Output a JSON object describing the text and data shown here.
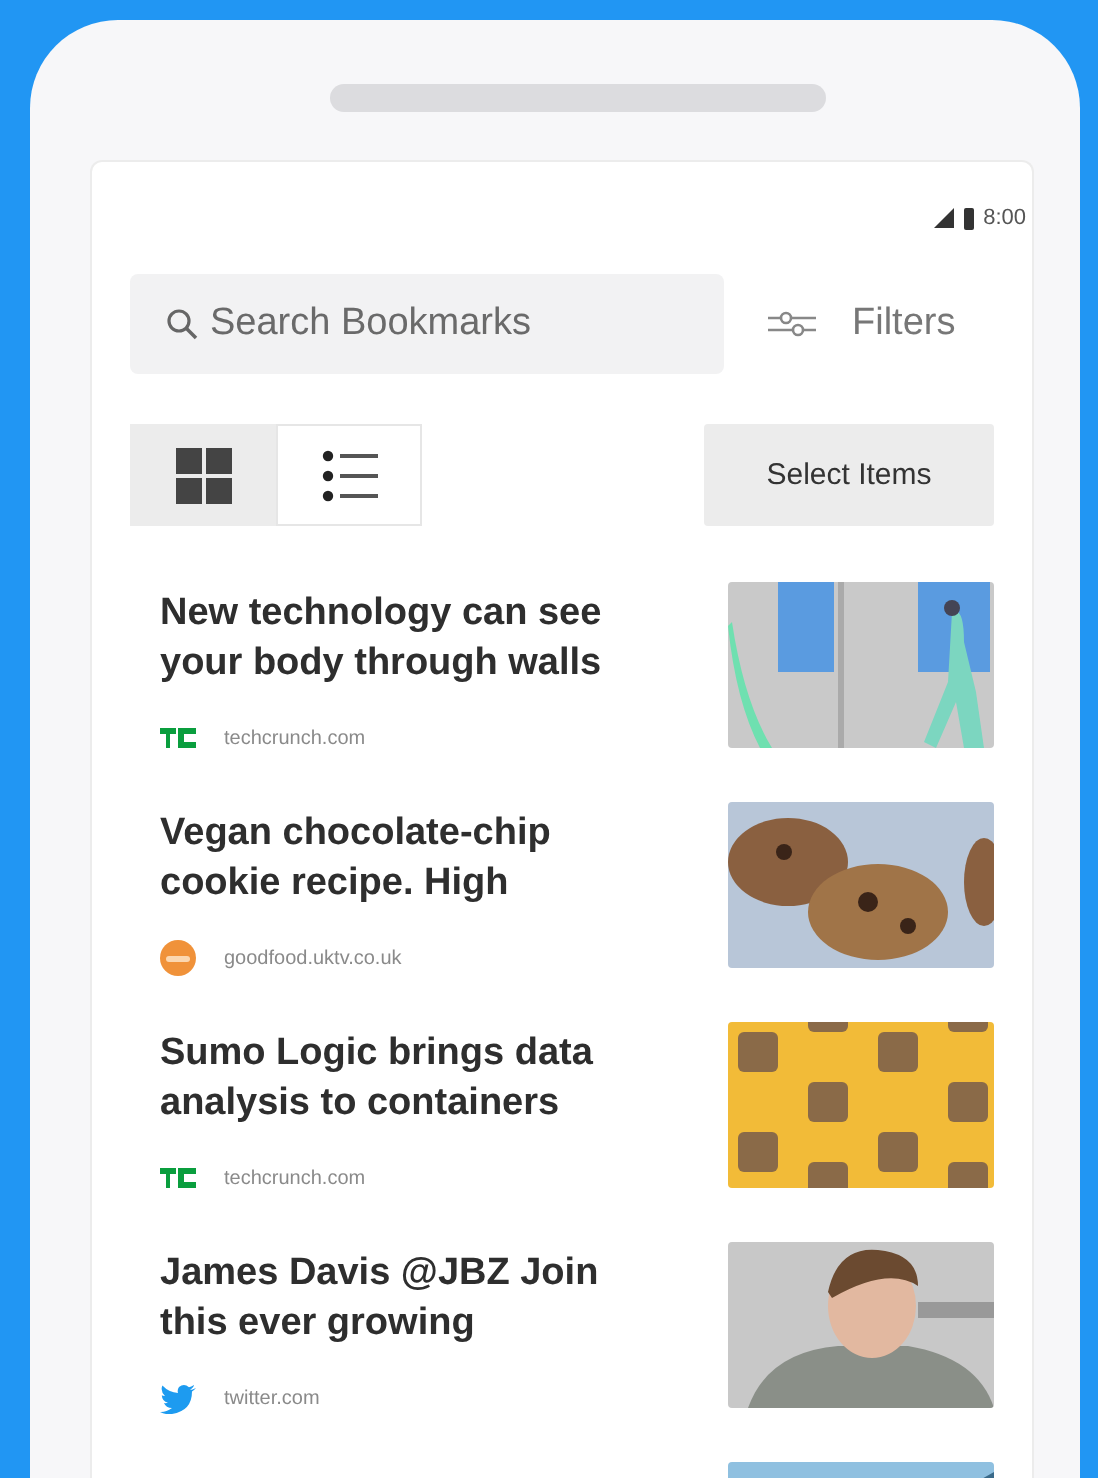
{
  "status_bar": {
    "time": "8:00"
  },
  "search": {
    "placeholder": "Search Bookmarks"
  },
  "filters_button": {
    "label": "Filters"
  },
  "view_toggle": [
    {
      "selected": false
    },
    {
      "selected": true
    }
  ],
  "select_button": {
    "label": "Select Items"
  },
  "bookmarks": [
    {
      "title": "New technology can see your body through walls",
      "source": "techcrunch.com",
      "kind": "tc"
    },
    {
      "title": "Vegan chocolate-chip cookie recipe. High",
      "source": "goodfood.uktv.co.uk",
      "kind": "food"
    },
    {
      "title": "Sumo Logic brings data analysis to containers",
      "source": "techcrunch.com",
      "kind": "tc"
    },
    {
      "title": "James Davis @JBZ Join this ever growing",
      "source": "twitter.com",
      "kind": "bird"
    }
  ]
}
